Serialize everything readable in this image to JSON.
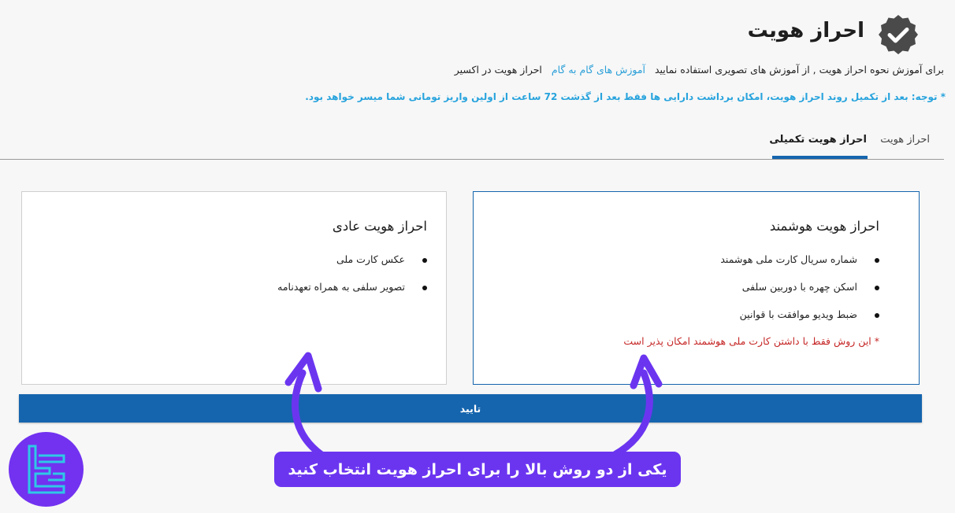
{
  "header": {
    "title": "احراز هویت",
    "intro_text": "برای آموزش نحوه احراز هویت , از آموزش های تصویری استفاده نمایید",
    "intro_link": "آموزش های گام به گام",
    "intro_suffix": "احراز هویت در اکسیر",
    "notice": "* توجه: بعد از تکمیل روند احراز هویت، امکان برداشت دارایی ها فقط بعد از گذشت 72 ساعت از اولین واریز تومانی شما میسر خواهد بود."
  },
  "tabs": [
    {
      "label": "احراز هویت",
      "active": false
    },
    {
      "label": "احراز هویت تکمیلی",
      "active": true
    }
  ],
  "cards": {
    "smart": {
      "title": "احراز هویت هوشمند",
      "items": [
        "شماره سریال کارت ملی هوشمند",
        "اسکن چهره با دوربین سلفی",
        "ضبط ویدیو موافقت با قوانین"
      ],
      "note": "* این روش فقط با داشتن کارت ملی هوشمند امکان پذیر است"
    },
    "normal": {
      "title": "احراز هویت عادی",
      "items": [
        "عکس کارت ملی",
        "تصویر سلفی به همراه تعهدنامه"
      ]
    }
  },
  "confirm_label": "تایید",
  "annotation": "یکی از دو روش بالا را برای احراز هویت انتخاب کنید",
  "icons": {
    "verified": "verified-badge-icon",
    "bullet": "bullet-icon",
    "arrow": "arrow-up-icon",
    "logo": "brand-logo-icon"
  },
  "colors": {
    "primary": "#1565ae",
    "link": "#27a3dd",
    "warning": "#c62828",
    "annotation": "#6b35f0"
  }
}
